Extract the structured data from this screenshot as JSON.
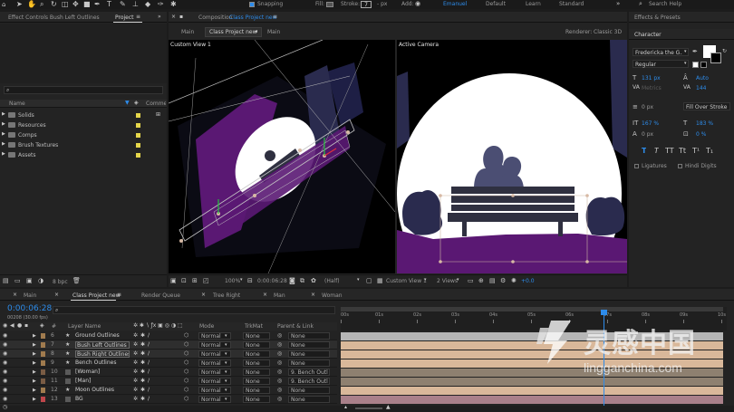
{
  "colors": {
    "accent": "#2d8ceb",
    "folder_label": "#e5d64a",
    "moon": "#ffffff",
    "sky": "#000000",
    "hill_purple": "#5a1873",
    "silhouette": "#4b4e73",
    "bench": "#2f3040",
    "bush": "#2a2b4e"
  },
  "toolbar": {
    "snapping_label": "Snapping",
    "fill_label": "Fill:",
    "stroke_label": "Stroke:",
    "stroke_value": "7",
    "stroke_unit": "- px",
    "add_label": "Add:",
    "workspaces": [
      "Emanuel",
      "Default",
      "Learn",
      "Standard"
    ],
    "search_placeholder": "Search Help"
  },
  "left_panel": {
    "tabs": [
      "Effect Controls Bush Left Outlines",
      "Project"
    ],
    "search_placeholder": "",
    "col_name": "Name",
    "col_comment": "Commen",
    "items": [
      {
        "label": "Solids"
      },
      {
        "label": "Resources"
      },
      {
        "label": "Comps"
      },
      {
        "label": "Brush Textures"
      },
      {
        "label": "Assets"
      }
    ],
    "bpc": "8 bpc"
  },
  "comp_panel": {
    "header_prefix": "Composition",
    "header_name": "Class Project new",
    "breadcrumbs": [
      "Main",
      "Class Project new",
      "Main"
    ],
    "renderer_label": "Renderer:",
    "renderer_value": "Classic 3D",
    "view_left_label": "Custom View 1",
    "view_right_label": "Active Camera",
    "footer": {
      "zoom": "100%",
      "timecode": "0:00:06:28",
      "resolution": "(Half)",
      "view": "Custom View 1",
      "layout": "2 Views",
      "exposure": "+0.0"
    }
  },
  "right_panel": {
    "effects_presets_label": "Effects & Presets",
    "character_label": "Character",
    "font_family": "Fredericka the G...",
    "font_style": "Regular",
    "font_size": "131 px",
    "leading": "Auto",
    "kerning": "Metrics",
    "tracking": "144",
    "stroke_width": "0 px",
    "stroke_type": "Fill Over Stroke",
    "vscale": "167 %",
    "hscale": "183 %",
    "baseline": "0 px",
    "tsume": "0 %",
    "style_buttons": [
      "T",
      "T",
      "TT",
      "Tt",
      "T¹",
      "T₁"
    ],
    "ligatures_label": "Ligatures",
    "hindi_label": "Hindi Digits"
  },
  "timeline": {
    "tabs": [
      "Main",
      "Class Project new",
      "Render Queue",
      "Tree Right",
      "Man",
      "Woman"
    ],
    "timecode": "0:00:06:28",
    "frames": "00208 (30.00 fps)",
    "columns": {
      "layer_name": "Layer Name",
      "mode": "Mode",
      "trkmat": "TrkMat",
      "parent": "Parent & Link"
    },
    "ruler": [
      "00s",
      "01s",
      "02s",
      "03s",
      "04s",
      "05s",
      "06s",
      "07s",
      "08s",
      "09s",
      "10s"
    ],
    "playhead_fraction": 0.69,
    "layers": [
      {
        "num": "6",
        "name": "Ground Outlines",
        "label_color": "#a07b4e",
        "star": true,
        "bracket": false,
        "mode": "Normal",
        "trkmat": "None",
        "parent": "None",
        "bar_color": "#b6b6b6",
        "selected": false
      },
      {
        "num": "7",
        "name": "Bush Left Outlines",
        "label_color": "#a07b4e",
        "star": true,
        "bracket": false,
        "mode": "Normal",
        "trkmat": "None",
        "parent": "None",
        "bar_color": "#d9b89a",
        "selected": true
      },
      {
        "num": "8",
        "name": "Bush Right Outlines",
        "label_color": "#a07b4e",
        "star": true,
        "bracket": false,
        "mode": "Normal",
        "trkmat": "None",
        "parent": "None",
        "bar_color": "#d9b89a",
        "selected": true
      },
      {
        "num": "9",
        "name": "Bench Outlines",
        "label_color": "#a07b4e",
        "star": true,
        "bracket": false,
        "mode": "Normal",
        "trkmat": "None",
        "parent": "None",
        "bar_color": "#d9b89a",
        "selected": false
      },
      {
        "num": "10",
        "name": "[Woman]",
        "label_color": "#7a5c44",
        "star": false,
        "bracket": true,
        "mode": "Normal",
        "trkmat": "None",
        "parent": "9. Bench Outl",
        "bar_color": "#8e8070",
        "selected": false
      },
      {
        "num": "11",
        "name": "[Man]",
        "label_color": "#7a5c44",
        "star": false,
        "bracket": true,
        "mode": "Normal",
        "trkmat": "None",
        "parent": "9. Bench Outl",
        "bar_color": "#8e8070",
        "selected": false
      },
      {
        "num": "12",
        "name": "Moon Outlines",
        "label_color": "#a07b4e",
        "star": true,
        "bracket": false,
        "mode": "Normal",
        "trkmat": "None",
        "parent": "None",
        "bar_color": "#d9b89a",
        "selected": false
      },
      {
        "num": "13",
        "name": "BG",
        "label_color": "#c0464b",
        "star": false,
        "bracket": false,
        "mode": "Normal",
        "trkmat": "None",
        "parent": "None",
        "bar_color": "#a9808a",
        "selected": false
      }
    ]
  },
  "watermark": {
    "cn": "灵感中国",
    "url": "lingganchina.com"
  }
}
